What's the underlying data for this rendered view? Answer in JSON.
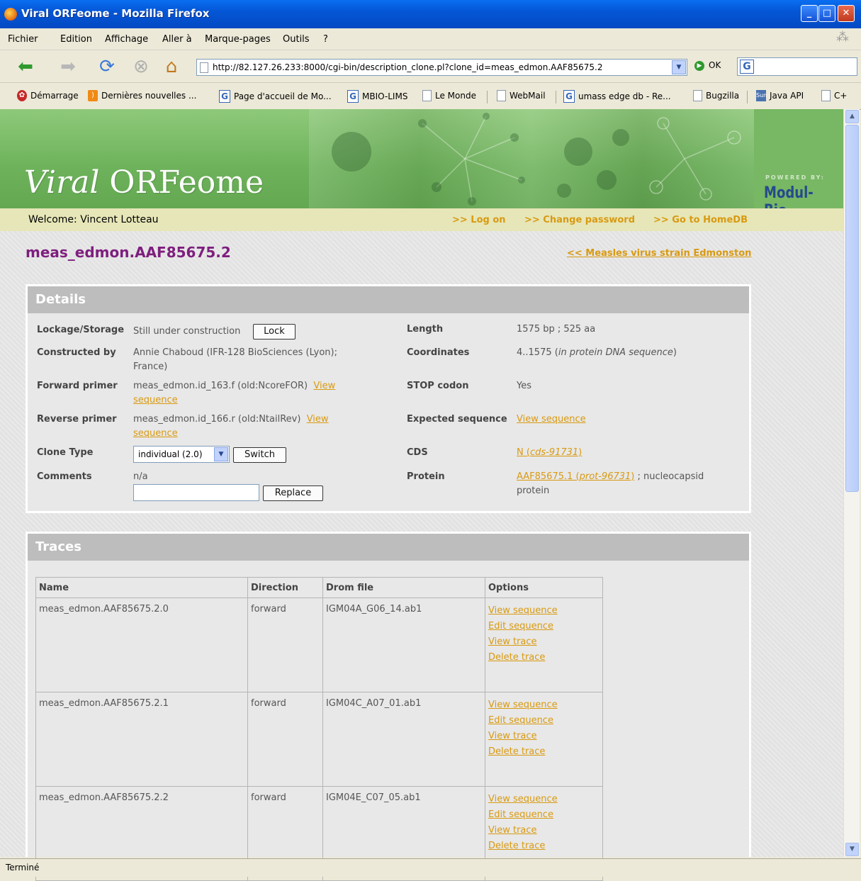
{
  "window": {
    "title": "Viral ORFeome - Mozilla Firefox"
  },
  "menu": [
    "Fichier",
    "Edition",
    "Affichage",
    "Aller à",
    "Marque-pages",
    "Outils",
    "?"
  ],
  "nav": {
    "url": "http://82.127.26.233:8000/cgi-bin/description_clone.pl?clone_id=meas_edmon.AAF85675.2",
    "go_label": "OK",
    "search_engine": "G"
  },
  "bookmarks": [
    "Démarrage",
    "Dernières nouvelles ...",
    "Page d'accueil de Mo...",
    "MBIO-LIMS",
    "Le Monde",
    "WebMail",
    "umass edge db - Re...",
    "Bugzilla",
    "Java API",
    "C+"
  ],
  "banner": {
    "title_italic": "Viral",
    "title_rest": " ORFeome",
    "powered_by": "POWERED BY:",
    "brand": "Modul-Bio"
  },
  "welcome": {
    "label": "Welcome: Vincent Lotteau",
    "links": [
      ">> Log on",
      ">> Change password",
      ">> Go to HomeDB"
    ]
  },
  "page": {
    "heading": "meas_edmon.AAF85675.2",
    "back_link": "<< Measles virus strain Edmonston"
  },
  "details": {
    "header": "Details",
    "lockage_label": "Lockage/Storage",
    "lockage_value": "Still under construction",
    "lock_button": "Lock",
    "constructed_label": "Constructed by",
    "constructed_value_1": "Annie Chaboud (IFR-128 BioSciences (Lyon);",
    "constructed_value_2": "France)",
    "fwd_label": "Forward primer",
    "fwd_value": "meas_edmon.id_163.f (old:NcoreFOR)",
    "rev_label": "Reverse primer",
    "rev_value": "meas_edmon.id_166.r (old:NtailRev)",
    "view_link_1": "View",
    "view_link_2": "sequence",
    "clone_type_label": "Clone Type",
    "clone_type_value": "individual (2.0)",
    "switch_button": "Switch",
    "comments_label": "Comments",
    "comments_value": "n/a",
    "replace_button": "Replace",
    "length_label": "Length",
    "length_value": "1575 bp ; 525 aa",
    "coord_label": "Coordinates",
    "coord_value": "4..1575 (",
    "coord_italic": "in protein DNA sequence",
    "coord_close": ")",
    "stop_label": "STOP codon",
    "stop_value": "Yes",
    "expected_label": "Expected sequence",
    "expected_link": "View sequence",
    "cds_label": "CDS",
    "cds_link_a": "N (",
    "cds_link_b": "cds-91731",
    "cds_link_c": ")",
    "protein_label": "Protein",
    "protein_link_a": "AAF85675.1 (",
    "protein_link_b": "prot-96731",
    "protein_link_c": ")",
    "protein_rest_1": " ; nucleocapsid",
    "protein_rest_2": "protein"
  },
  "traces": {
    "header": "Traces",
    "columns": [
      "Name",
      "Direction",
      "Drom file",
      "Options"
    ],
    "rows": [
      {
        "name": "meas_edmon.AAF85675.2.0",
        "direction": "forward",
        "file": "IGM04A_G06_14.ab1"
      },
      {
        "name": "meas_edmon.AAF85675.2.1",
        "direction": "forward",
        "file": "IGM04C_A07_01.ab1"
      },
      {
        "name": "meas_edmon.AAF85675.2.2",
        "direction": "forward",
        "file": "IGM04E_C07_05.ab1"
      }
    ],
    "options": [
      "View sequence",
      "Edit sequence",
      "View trace",
      "Delete trace"
    ]
  },
  "status": "Terminé"
}
